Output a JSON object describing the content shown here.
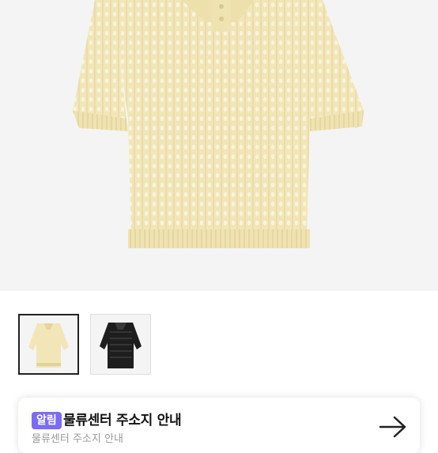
{
  "product": {
    "main_image": "cream-knit-polo-top",
    "thumbnails": [
      {
        "name": "cream-knit-polo-top",
        "selected": true
      },
      {
        "name": "black-knit-polo-top",
        "selected": false
      }
    ]
  },
  "notice": {
    "badge": "알림",
    "title": "물류센터 주소지 안내",
    "subtitle": "물류센터 주소지 안내",
    "arrow_icon": "arrow-right-icon"
  },
  "colors": {
    "badge": "#7b6cf6",
    "knit_cream": "#f3e8bd",
    "knit_black": "#1e1e1e"
  }
}
